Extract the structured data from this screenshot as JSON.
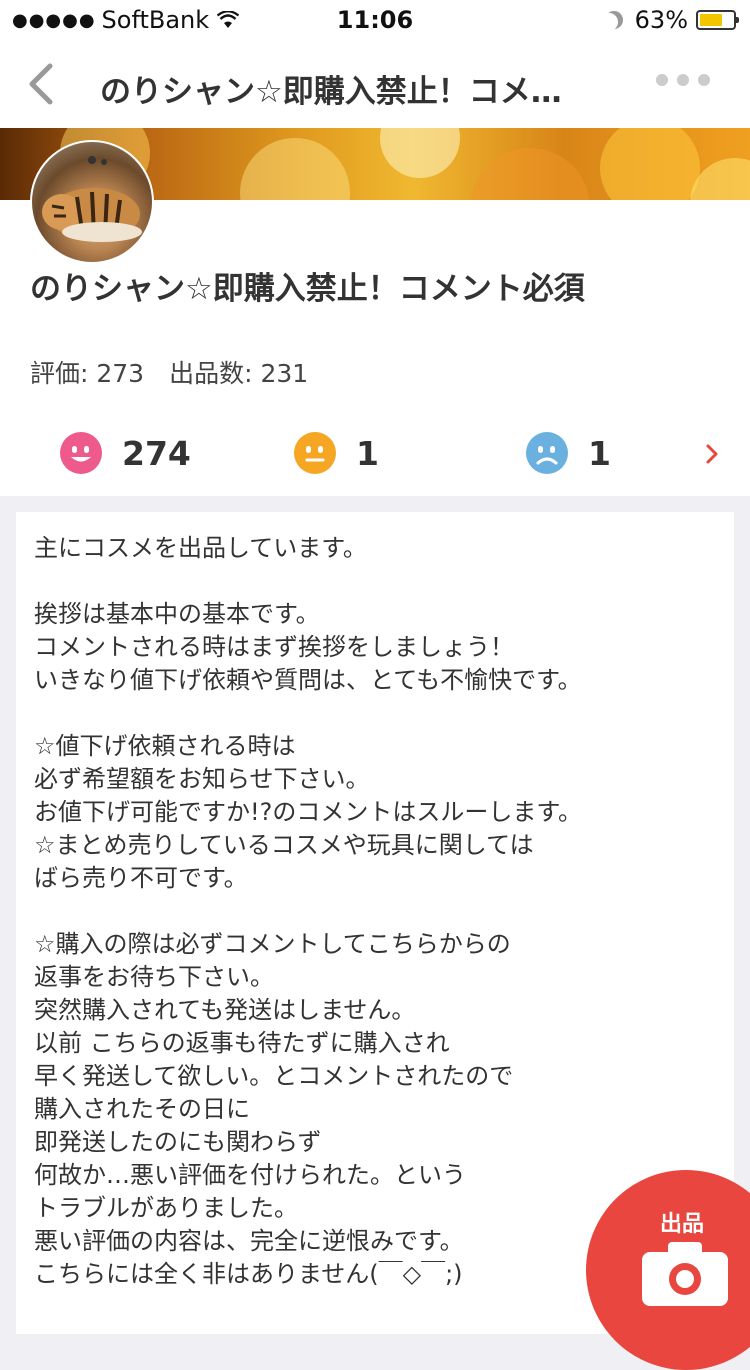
{
  "status_bar": {
    "carrier": "SoftBank",
    "time": "11:06",
    "battery": "63%",
    "battery_level": 0.63
  },
  "nav": {
    "title": "のりシャン☆即購入禁止！コメ…"
  },
  "profile": {
    "name": "のりシャン☆即購入禁止！コメント必須",
    "stats": "評価: 273　出品数: 231",
    "ratings": {
      "good": "274",
      "normal": "1",
      "bad": "1"
    }
  },
  "bio": {
    "text": "主にコスメを出品しています。\n\n挨拶は基本中の基本です。\nコメントされる時はまず挨拶をしましょう！\nいきなり値下げ依頼や質問は、とても不愉快です。\n\n☆値下げ依頼される時は\n必ず希望額をお知らせ下さい。\nお値下げ可能ですか!?のコメントはスルーします。\n☆まとめ売りしているコスメや玩具に関しては\nばら売り不可です。\n\n☆購入の際は必ずコメントしてこちらからの\n返事をお待ち下さい。\n突然購入されても発送はしません。\n以前 こちらの返事も待たずに購入され\n早く発送して欲しい。とコメントされたので\n購入されたその日に\n即発送したのにも関わらず\n何故か…悪い評価を付けられた。という\nトラブルがありました。\n悪い評価の内容は、完全に逆恨みです。\nこちらには全く非はありません(￣◇￣;)"
  },
  "fab": {
    "label": "出品"
  },
  "colors": {
    "accent": "#e8463e",
    "good": "#ef5a8c",
    "normal": "#f5a623",
    "bad": "#6bb1e0"
  }
}
